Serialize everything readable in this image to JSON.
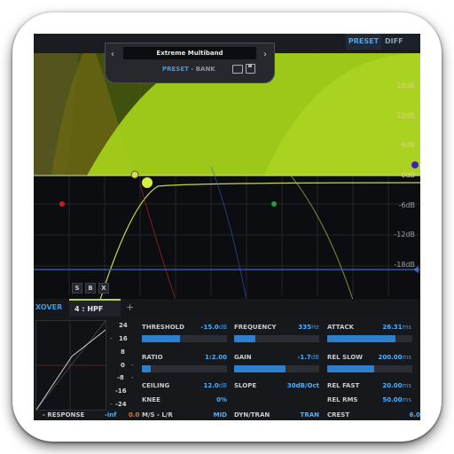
{
  "header": {
    "preset_tab": "PRESET",
    "diff_tab": "DIFF"
  },
  "preset_panel": {
    "prev_arrow": "‹",
    "next_arrow": "›",
    "name": "Extreme Multiband",
    "preset_label": "PRESET",
    "separator": " - ",
    "bank_label": "BANK",
    "icons": [
      "folder-icon",
      "save-icon"
    ]
  },
  "graph": {
    "db_labels": [
      "18dB",
      "12dB",
      "6dB",
      "0dB",
      "-6dB",
      "-12dB",
      "-18dB"
    ],
    "colors": {
      "band_fill": "#a6d21a",
      "background": "#0c0d10",
      "accent": "#3f9ae0"
    }
  },
  "band_buttons": [
    "S",
    "B",
    "X"
  ],
  "tabs": {
    "xover": "XOVER",
    "hpf": "4 : HPF",
    "add": "+"
  },
  "scale": {
    "values": [
      "24",
      "16",
      "8",
      "0",
      "-8",
      "-16",
      "-24"
    ],
    "ticks": [
      "-",
      "-",
      "-",
      "-",
      "-",
      "-",
      "-"
    ]
  },
  "params": {
    "threshold": {
      "label": "THRESHOLD",
      "value": "-15.0",
      "unit": "dB",
      "fill": 0.45
    },
    "ratio": {
      "label": "RATIO",
      "value": "1:2.00",
      "unit": "",
      "fill": 0.1
    },
    "ceiling": {
      "label": "CEILING",
      "value": "12.0",
      "unit": "dB"
    },
    "knee": {
      "label": "KNEE",
      "value": "0%",
      "unit": ""
    },
    "ms": {
      "label": "M/S - L/R",
      "value": "MID",
      "unit": ""
    },
    "frequency": {
      "label": "FREQUENCY",
      "value": "335",
      "unit": "Hz",
      "fill": 0.25
    },
    "gain": {
      "label": "GAIN",
      "value": "-1.7",
      "unit": "dB",
      "fill": 0.6
    },
    "slope": {
      "label": "SLOPE",
      "value": "30dB/Oct",
      "unit": ""
    },
    "dyntran": {
      "label": "DYN/TRAN",
      "value": "TRAN",
      "unit": ""
    },
    "attack": {
      "label": "ATTACK",
      "value": "26.31",
      "unit": "ms",
      "fill": 0.8
    },
    "relslow": {
      "label": "REL SLOW",
      "value": "200.00",
      "unit": "ms",
      "fill": 0.55
    },
    "relfast": {
      "label": "REL FAST",
      "value": "20.00",
      "unit": "ms"
    },
    "relrms": {
      "label": "REL RMS",
      "value": "50.00",
      "unit": "ms"
    },
    "crest": {
      "label": "CREST",
      "value": "6.0",
      "unit": ""
    }
  },
  "response": {
    "label": "- RESPONSE",
    "value1": "-inf",
    "value2": "0.0"
  }
}
